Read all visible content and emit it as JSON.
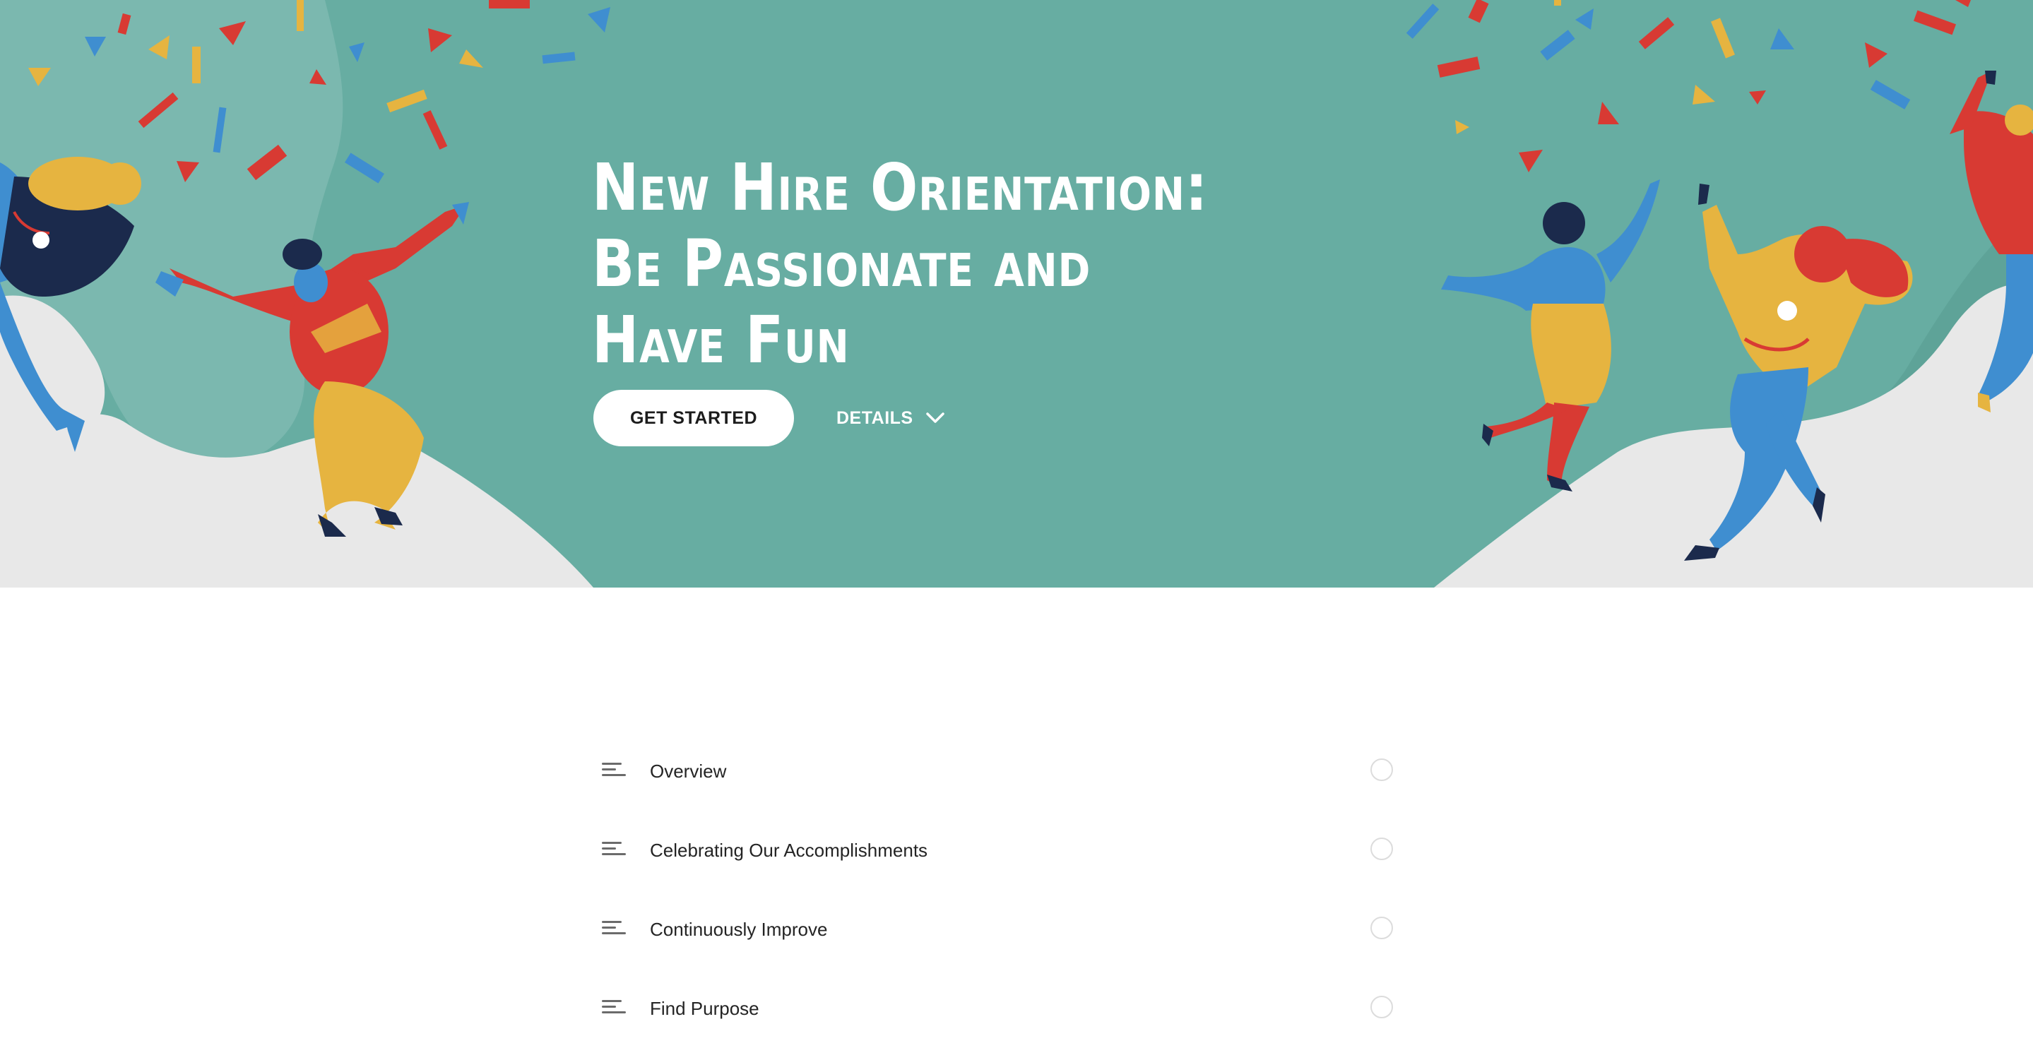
{
  "course": {
    "title": "New Hire Orientation: Be Passionate and Have Fun"
  },
  "actions": {
    "get_started_label": "GET STARTED",
    "details_label": "DETAILS",
    "details_icon": "chevron-down-icon"
  },
  "lessons": [
    {
      "title": "Overview",
      "icon": "lesson-text-icon",
      "status": "not-started"
    },
    {
      "title": "Celebrating Our Accomplishments",
      "icon": "lesson-text-icon",
      "status": "not-started"
    },
    {
      "title": "Continuously Improve",
      "icon": "lesson-text-icon",
      "status": "not-started"
    },
    {
      "title": "Find Purpose",
      "icon": "lesson-text-icon",
      "status": "not-started"
    }
  ],
  "colors": {
    "hero_background": "#67ada2",
    "confetti_red": "#d83a33",
    "confetti_yellow": "#e6b440",
    "confetti_blue": "#3f8ed0",
    "navy": "#1b2a4c",
    "snow": "#e9e9e9"
  }
}
